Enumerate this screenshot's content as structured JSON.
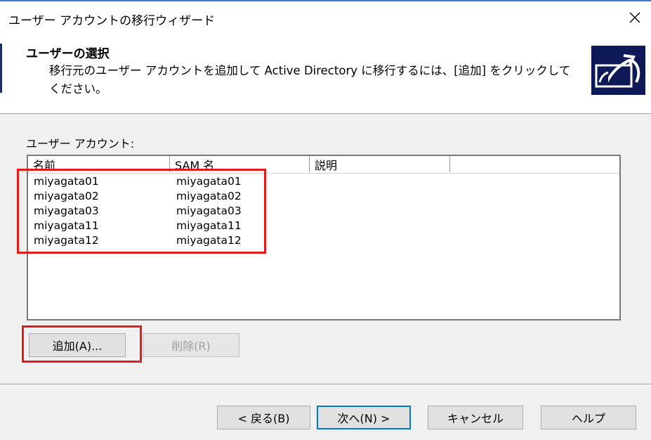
{
  "window": {
    "title": "ユーザー アカウントの移行ウィザード",
    "close_icon": "close-icon",
    "accent_color": "#3b7bd8"
  },
  "header": {
    "title": "ユーザーの選択",
    "description": "移行元のユーザー アカウントを追加して Active Directory に移行するには、[追加] をクリックしてください。",
    "logo_icon": "migration-wizard-logo-icon",
    "logo_color": "#0d1a57"
  },
  "accounts": {
    "label": "ユーザー アカウント:",
    "columns": [
      "名前",
      "SAM 名",
      "説明"
    ],
    "rows": [
      [
        "miyagata01",
        "miyagata01",
        ""
      ],
      [
        "miyagata02",
        "miyagata02",
        ""
      ],
      [
        "miyagata03",
        "miyagata03",
        ""
      ],
      [
        "miyagata11",
        "miyagata11",
        ""
      ],
      [
        "miyagata12",
        "miyagata12",
        ""
      ]
    ]
  },
  "actions": {
    "add_label": "追加(A)...",
    "remove_label": "削除(R)"
  },
  "footer": {
    "back_label": "< 戻る(B)",
    "next_label": "次へ(N) >",
    "cancel_label": "キャンセル",
    "help_label": "ヘルプ"
  },
  "highlight_color": "#e41c1c"
}
